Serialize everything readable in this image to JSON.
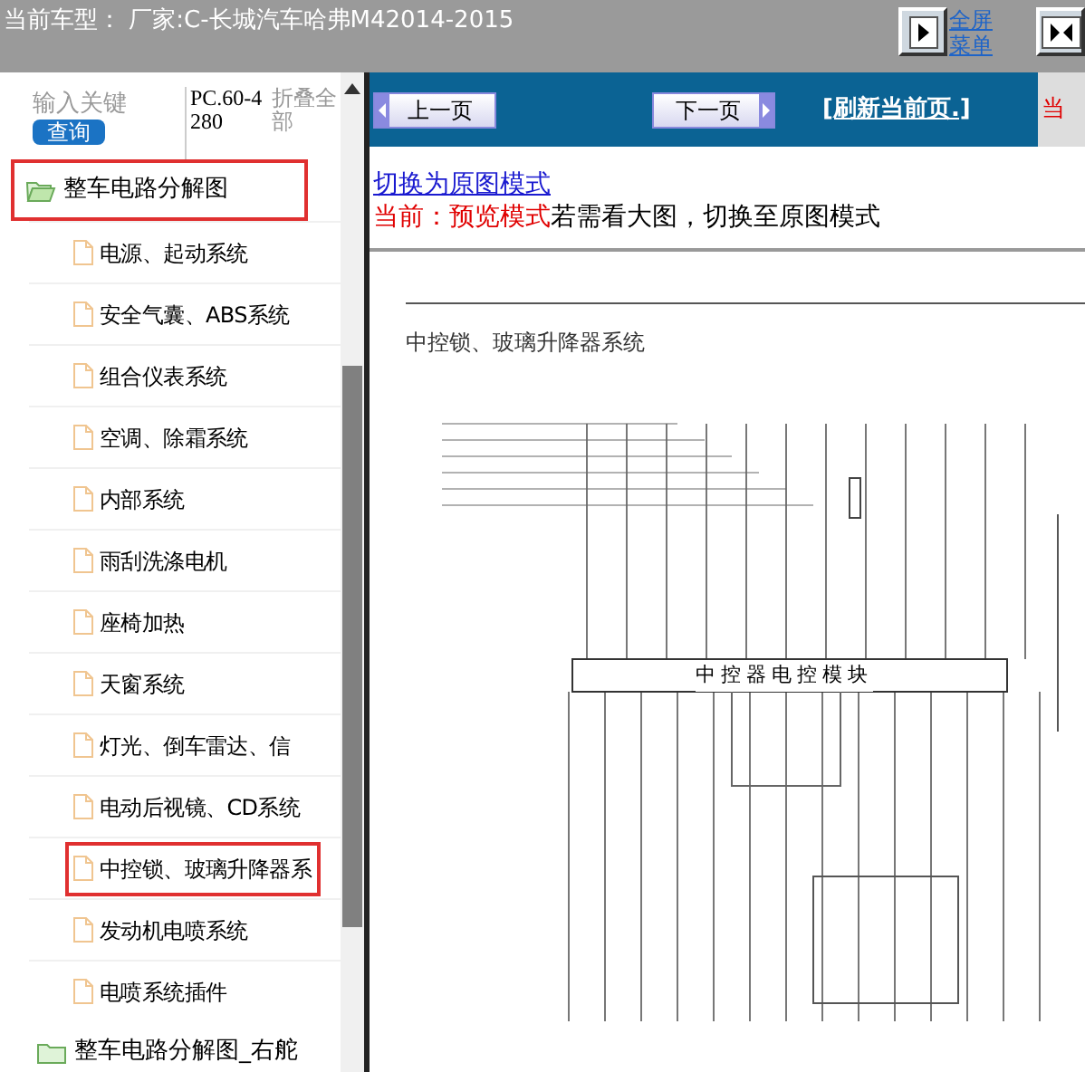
{
  "header": {
    "title": "当前车型： 厂家:C-长城汽车哈弗M42014-2015",
    "buttons": [
      {
        "kind": "expand",
        "label": "全屏菜单"
      },
      {
        "kind": "split"
      }
    ]
  },
  "sidebar": {
    "search": {
      "placeholder": "输入关键",
      "button": "查询"
    },
    "model_code": "PC.60-4280",
    "collapse_all": "折叠全部",
    "tree": [
      {
        "label": "整车电路分解图",
        "expanded": true,
        "selected": true,
        "children": [
          {
            "label": "电源、起动系统",
            "selected": false
          },
          {
            "label": "安全气囊、ABS系统",
            "selected": false
          },
          {
            "label": "组合仪表系统",
            "selected": false
          },
          {
            "label": "空调、除霜系统",
            "selected": false
          },
          {
            "label": "内部系统",
            "selected": false
          },
          {
            "label": "雨刮洗涤电机",
            "selected": false
          },
          {
            "label": "座椅加热",
            "selected": false
          },
          {
            "label": "天窗系统",
            "selected": false
          },
          {
            "label": "灯光、倒车雷达、信",
            "selected": false
          },
          {
            "label": "电动后视镜、CD系统",
            "selected": false
          },
          {
            "label": "中控锁、玻璃升降器系",
            "selected": true
          },
          {
            "label": "发动机电喷系统",
            "selected": false
          },
          {
            "label": "电喷系统插件",
            "selected": false
          }
        ]
      },
      {
        "label": "整车电路分解图_右舵",
        "expanded": false,
        "selected": false
      }
    ]
  },
  "toolbar": {
    "prev": "上一页",
    "next": "下一页",
    "refresh": "[刷新当前页.]",
    "current": "当"
  },
  "mode": {
    "switch_link": "切换为原图模式",
    "current_label": "当前：预览模式",
    "hint": "若需看大图，切换至原图模式"
  },
  "diagram": {
    "title": "中控锁、玻璃升降器系统",
    "module_label": "中控器电控模块"
  }
}
